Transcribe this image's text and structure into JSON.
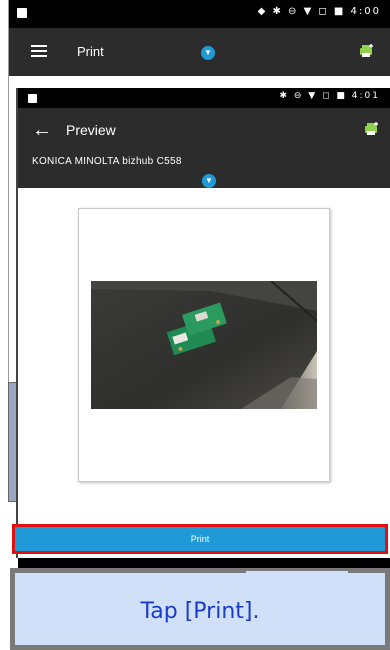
{
  "back_screen": {
    "status_bar": {
      "right_text": "◆ ✱ ⊖ ▼ ◻ ■ 4:00"
    },
    "toolbar": {
      "title": "Print",
      "menu_icon": "hamburger-menu-icon",
      "add_printer_icon": "add-printer-icon"
    }
  },
  "front_screen": {
    "status_bar": {
      "right_text": "✱ ⊖ ▼ ◻ ■ 4:01"
    },
    "toolbar": {
      "title": "Preview",
      "printer_name": "KONICA MINOLTA bizhub C558",
      "back_icon": "arrow-left-icon"
    }
  },
  "print_button": {
    "label": "Print"
  },
  "callout": {
    "text": "Tap [Print]."
  },
  "colors": {
    "accent": "#1f9ad6",
    "highlight": "#e01010",
    "toolbar": "#2c2c2c",
    "callout_bg": "#cfe0f8",
    "callout_text": "#1a3cc8"
  }
}
